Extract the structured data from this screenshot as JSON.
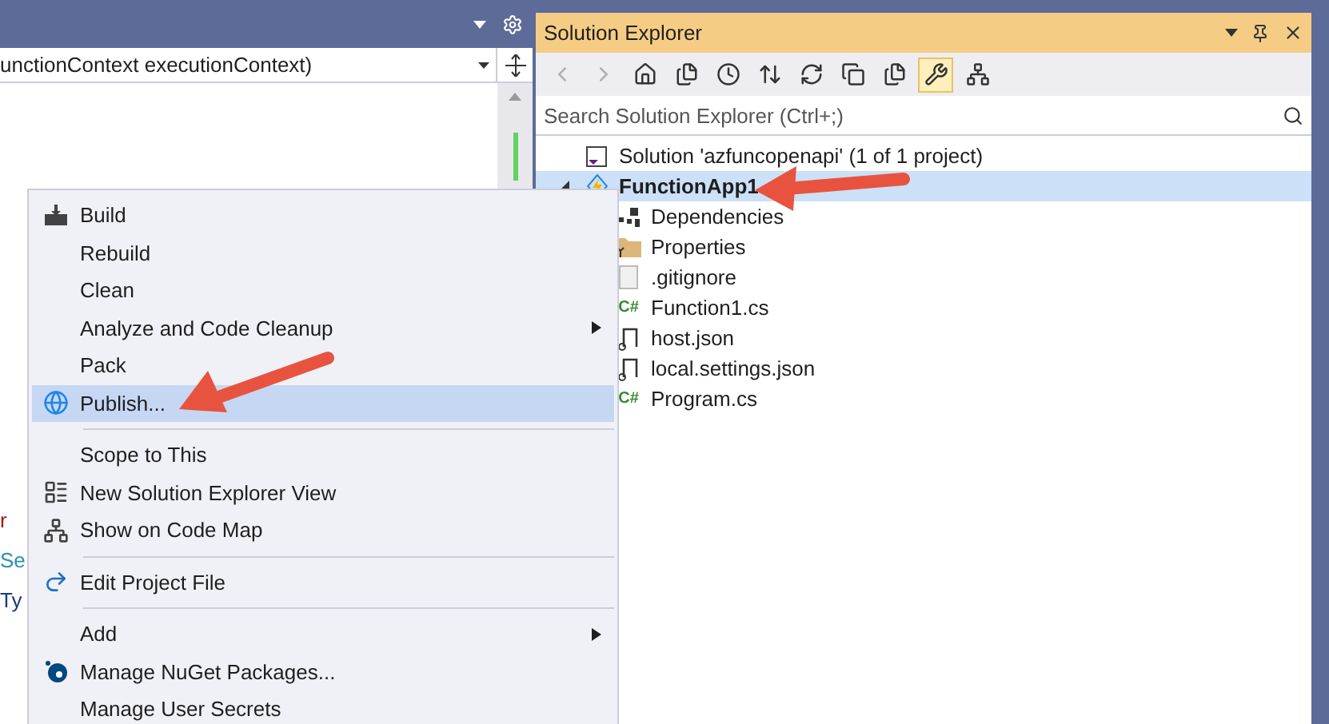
{
  "editor": {
    "member_dropdown": {
      "value": "unctionContext executionContext)"
    },
    "code_fragments": [
      {
        "text": "r",
        "color": "#a31515"
      },
      {
        "text": "Se",
        "color": "#2b91af"
      },
      {
        "text": "Ty",
        "color": "#1f377f"
      }
    ]
  },
  "solution_explorer": {
    "title": "Solution Explorer",
    "toolbar": [
      {
        "selected": false,
        "disabled": true
      },
      {
        "selected": false,
        "disabled": true
      },
      {
        "selected": false,
        "disabled": false
      },
      {
        "selected": false,
        "disabled": false
      },
      {
        "selected": false,
        "disabled": false
      },
      {
        "selected": false,
        "disabled": false
      },
      {
        "selected": false,
        "disabled": false
      },
      {
        "selected": false,
        "disabled": false
      },
      {
        "selected": false,
        "disabled": false
      },
      {
        "selected": true,
        "disabled": false
      },
      {
        "selected": false,
        "disabled": false
      }
    ],
    "search": {
      "placeholder": "Search Solution Explorer (Ctrl+;)"
    },
    "tree": [
      {
        "kind": "solution",
        "label": "Solution 'azfuncopenapi' (1 of 1 project)",
        "selected": false,
        "children": [
          {
            "kind": "project",
            "label": "FunctionApp1",
            "selected": true,
            "expanded": true,
            "children": [
              {
                "kind": "dependencies",
                "label": "Dependencies",
                "selected": false
              },
              {
                "kind": "folder",
                "label": "Properties",
                "selected": false
              },
              {
                "kind": "file",
                "label": ".gitignore",
                "selected": false
              },
              {
                "kind": "csharp",
                "label": "Function1.cs",
                "badge": "C#",
                "selected": false
              },
              {
                "kind": "json",
                "label": "host.json",
                "selected": false
              },
              {
                "kind": "json",
                "label": "local.settings.json",
                "selected": false
              },
              {
                "kind": "csharp",
                "label": "Program.cs",
                "badge": "C#",
                "selected": false
              }
            ]
          }
        ]
      }
    ]
  },
  "context_menu": {
    "groups": [
      [
        {
          "label": "Build",
          "submenu": false,
          "selected": false
        },
        {
          "label": "Rebuild",
          "submenu": false,
          "selected": false
        },
        {
          "label": "Clean",
          "submenu": false,
          "selected": false
        },
        {
          "label": "Analyze and Code Cleanup",
          "submenu": true,
          "selected": false
        },
        {
          "label": "Pack",
          "submenu": false,
          "selected": false
        },
        {
          "label": "Publish...",
          "submenu": false,
          "selected": true
        }
      ],
      [
        {
          "label": "Scope to This",
          "submenu": false,
          "selected": false
        },
        {
          "label": "New Solution Explorer View",
          "submenu": false,
          "selected": false
        },
        {
          "label": "Show on Code Map",
          "submenu": false,
          "selected": false
        }
      ],
      [
        {
          "label": "Edit Project File",
          "submenu": false,
          "selected": false
        }
      ],
      [
        {
          "label": "Add",
          "submenu": true,
          "selected": false
        },
        {
          "label": "Manage NuGet Packages...",
          "submenu": false,
          "selected": false
        },
        {
          "label": "Manage User Secrets",
          "submenu": false,
          "selected": false
        }
      ]
    ]
  }
}
